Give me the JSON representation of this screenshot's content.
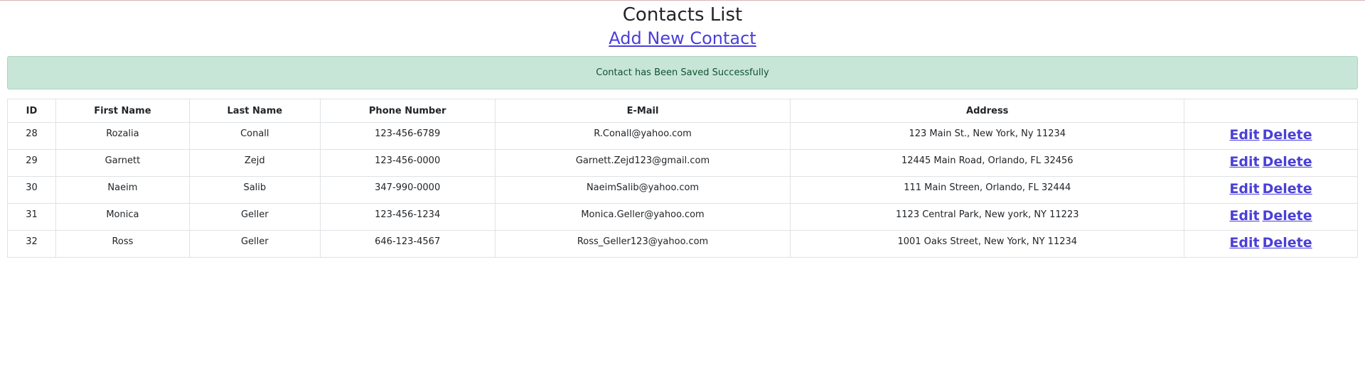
{
  "page": {
    "title": "Contacts List",
    "add_link": "Add New Contact",
    "alert": "Contact has Been Saved Successfully"
  },
  "table": {
    "headers": [
      "ID",
      "First Name",
      "Last Name",
      "Phone Number",
      "E-Mail",
      "Address",
      ""
    ],
    "rows": [
      {
        "id": "28",
        "first": "Rozalia",
        "last": "Conall",
        "phone": "123-456-6789",
        "email": "R.Conall@yahoo.com",
        "address": "123 Main St., New York, Ny 11234"
      },
      {
        "id": "29",
        "first": "Garnett",
        "last": "Zejd",
        "phone": "123-456-0000",
        "email": "Garnett.Zejd123@gmail.com",
        "address": "12445 Main Road, Orlando, FL 32456"
      },
      {
        "id": "30",
        "first": "Naeim",
        "last": "Salib",
        "phone": "347-990-0000",
        "email": "NaeimSalib@yahoo.com",
        "address": "111 Main Streen, Orlando, FL 32444"
      },
      {
        "id": "31",
        "first": "Monica",
        "last": "Geller",
        "phone": "123-456-1234",
        "email": "Monica.Geller@yahoo.com",
        "address": "1123 Central Park, New york, NY 11223"
      },
      {
        "id": "32",
        "first": "Ross",
        "last": "Geller",
        "phone": "646-123-4567",
        "email": "Ross_Geller123@yahoo.com",
        "address": "1001 Oaks Street, New York, NY 11234"
      }
    ],
    "actions": {
      "edit_label": "Edit",
      "delete_label": "Delete"
    }
  },
  "colors": {
    "link": "#4a3fd9",
    "alert_bg": "#c8e6d7",
    "alert_text": "#0f5132"
  }
}
